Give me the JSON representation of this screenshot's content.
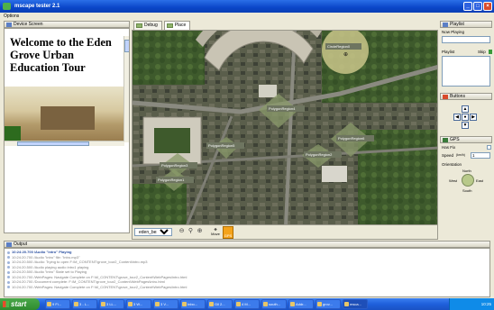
{
  "window": {
    "title": "mscape tester 2.1"
  },
  "menu": {
    "options": "Options"
  },
  "device_panel": {
    "title": "Device Screen",
    "welcome_text": "Welcome to the Eden Grove Urban Education Tour"
  },
  "tabs": [
    {
      "label": "Debug"
    },
    {
      "label": "Place"
    }
  ],
  "map": {
    "regions": [
      {
        "label": "CircleRegion0"
      },
      {
        "label": "PolygonRegion4"
      },
      {
        "label": "PolygonRegion5"
      },
      {
        "label": "PolygonRegion6"
      },
      {
        "label": "PolygonRegion3"
      },
      {
        "label": "PolygonRegion2"
      },
      {
        "label": "PolygonRegion1"
      }
    ],
    "layer_select": "eden_best",
    "move_label": "Move",
    "gps_label": "GPS"
  },
  "playlist": {
    "title": "Playlist",
    "now_playing_label": "Now Playing",
    "playlist_label": "Playlist",
    "skip_label": "Skip"
  },
  "buttons_panel": {
    "title": "Buttons"
  },
  "gps_panel": {
    "title": "GPS",
    "has_fix_label": "Has Fix",
    "speed_label": "Speed",
    "speed_unit": "(km/h)",
    "speed_value": "1",
    "orientation_label": "Orientation",
    "north": "North",
    "south": "South",
    "east": "East",
    "west": "West"
  },
  "output": {
    "title": "Output",
    "lines": [
      "10:24:20.700 /Audio \"intro\" Playing",
      "10:24:20.700 /Audio \"intro\" file: \"intro.mp3\"",
      "10:24:20.500 /Audio: Trying to open F:\\M_CONTENT\\grove_tour2_Content\\intro.mp3",
      "10:24:20.500 /Audio playing audio intro1 playing",
      "10:24:20.500 /Audio \"intro\" State set to Playing",
      "10:24:20.700 /WebPages: Navigate Complete on F:\\M_CONTENT\\grove_tour2_Content\\WebPages\\intro.html",
      "10:24:20.700 /Document complete: F:\\M_CONTENT\\grove_tour2_Content\\WebPages\\intro.html",
      "10:24:20.700 /WebPages: Navigate Complete on F:\\M_CONTENT\\grove_tour2_Content\\WebPages\\intro.html"
    ]
  },
  "taskbar": {
    "start_label": "start",
    "tasks": [
      "9 Fi...",
      "3 - L...",
      "3 LL...",
      "3 W...",
      "3 V...",
      "Inbo...",
      "Gil 2...",
      "4 M...",
      "south...",
      "Addr...",
      "grov...",
      "msca..."
    ],
    "clock": "10:25"
  }
}
